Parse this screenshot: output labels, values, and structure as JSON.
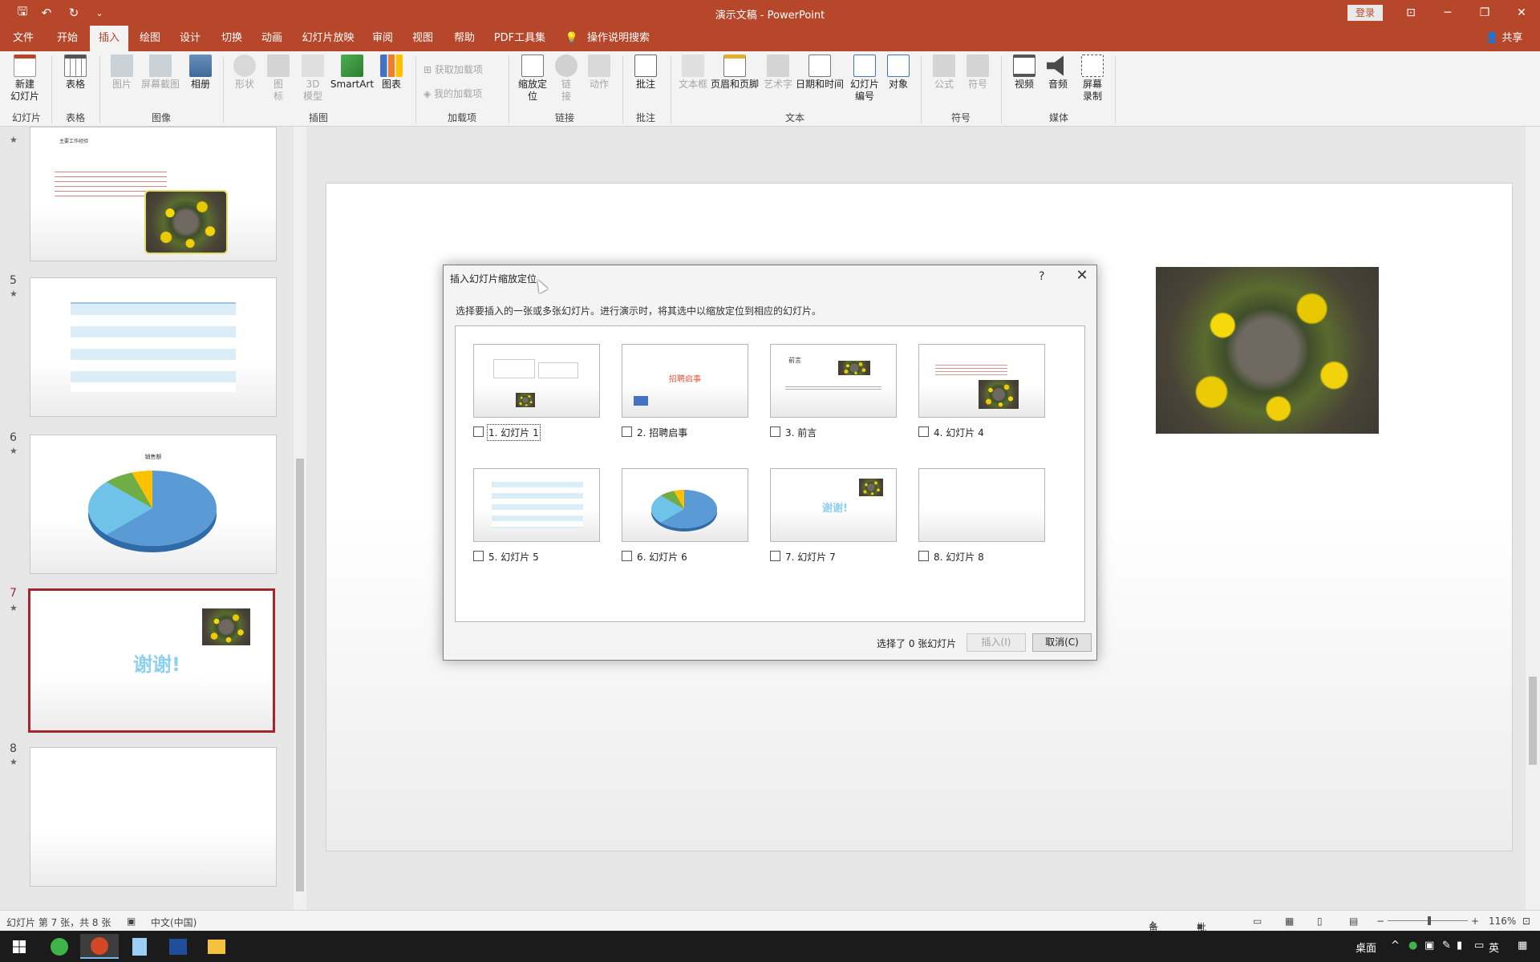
{
  "window": {
    "title": "演示文稿 - PowerPoint",
    "login_label": "登录",
    "minimize": "─",
    "restore": "❐",
    "close": "✕",
    "ribbon_display": "⊡"
  },
  "quick_access": {
    "save": "🖫",
    "undo": "↶",
    "redo": "↻",
    "customize": "⌄"
  },
  "menu": {
    "tabs": [
      "文件",
      "开始",
      "插入",
      "绘图",
      "设计",
      "切换",
      "动画",
      "幻灯片放映",
      "审阅",
      "视图",
      "帮助",
      "PDF工具集"
    ],
    "active": "插入",
    "search_label": "操作说明搜索",
    "share_label": "共享"
  },
  "ribbon": {
    "groups": {
      "slides": "幻灯片",
      "tables": "表格",
      "images": "图像",
      "illustrations": "插图",
      "addins": "加载项",
      "links": "链接",
      "comments": "批注",
      "text": "文本",
      "symbols": "符号",
      "media": "媒体"
    },
    "buttons": {
      "new_slide": "新建\n幻灯片",
      "table": "表格",
      "picture": "图片",
      "screenshot": "屏幕截图",
      "album": "相册",
      "shapes": "形状",
      "icons": "图\n标",
      "model3d": "3D\n模型",
      "smartart": "SmartArt",
      "chart": "图表",
      "get_addins": "获取加载项",
      "my_addins": "我的加载项",
      "zoom": "缩放定\n位",
      "link": "链\n接",
      "action": "动作",
      "comment": "批注",
      "textbox": "文本框",
      "header_footer": "页眉和页脚",
      "wordart": "艺术字",
      "datetime": "日期和时间",
      "slide_number": "幻灯片\n编号",
      "object": "对象",
      "equation": "公式",
      "symbol": "符号",
      "video": "视频",
      "audio": "音频",
      "screen_record": "屏幕\n录制"
    }
  },
  "thumbnails": {
    "numbers": [
      "5",
      "6",
      "7",
      "8"
    ],
    "star": "★",
    "slide4_heading": "主要工作经验",
    "slide6_title": "销售额",
    "slide7_text": "谢谢!"
  },
  "dialog": {
    "title": "插入幻灯片缩放定位",
    "help": "?",
    "close": "✕",
    "instruction": "选择要插入的一张或多张幻灯片。进行演示时，将其选中以缩放定位到相应的幻灯片。",
    "slides": [
      {
        "label": "1. 幻灯片 1",
        "checked": false
      },
      {
        "label": "2. 招聘启事",
        "checked": false
      },
      {
        "label": "3. 前言",
        "checked": false
      },
      {
        "label": "4. 幻灯片 4",
        "checked": false
      },
      {
        "label": "5. 幻灯片 5",
        "checked": false
      },
      {
        "label": "6. 幻灯片 6",
        "checked": false
      },
      {
        "label": "7. 幻灯片 7",
        "checked": false
      },
      {
        "label": "8. 幻灯片 8",
        "checked": false
      }
    ],
    "mini_text": {
      "s2_title": "招聘启事",
      "s3_title": "前言",
      "s7_text": "谢谢!"
    },
    "status": "选择了 0 张幻灯片",
    "insert_label": "插入(I)",
    "cancel_label": "取消(C)"
  },
  "statusbar": {
    "slide_info": "幻灯片 第 7 张，共 8 张",
    "language": "中文(中国)",
    "notes": "备注",
    "comments": "批注",
    "zoom": "116%",
    "zoom_minus": "−",
    "zoom_plus": "+"
  },
  "taskbar": {
    "desktop_label": "桌面",
    "ime": "英",
    "chevron": "^"
  },
  "colors": {
    "accent": "#b7472a",
    "selection": "#a4262c"
  }
}
